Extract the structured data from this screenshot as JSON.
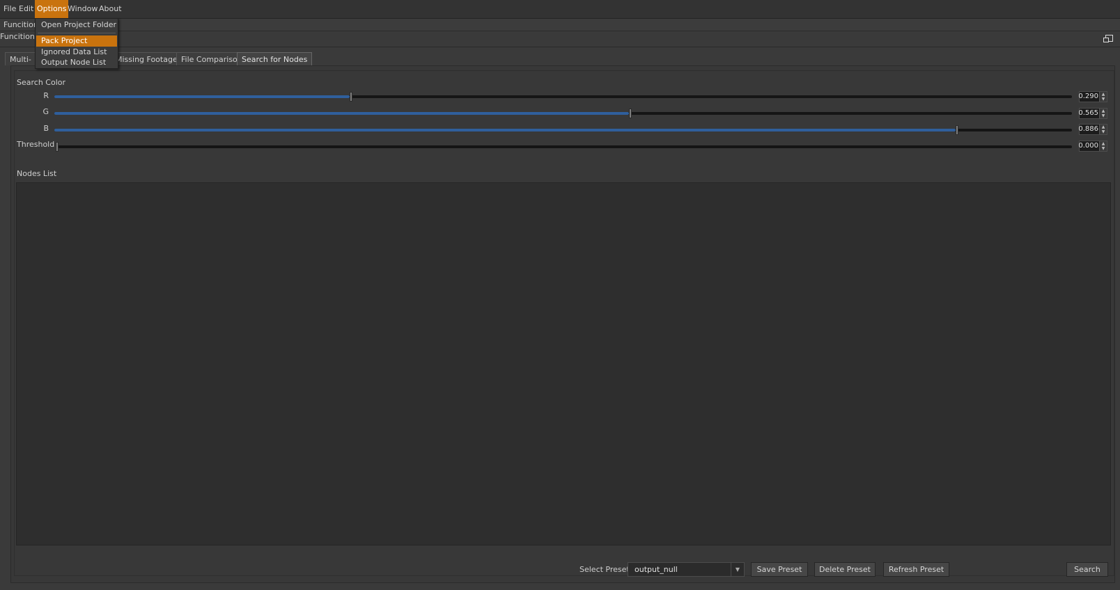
{
  "menubar": {
    "items": [
      {
        "label": "File"
      },
      {
        "label": "Edit"
      },
      {
        "label": "Options"
      },
      {
        "label": "Window"
      },
      {
        "label": "About"
      }
    ],
    "active": "Options"
  },
  "options_menu": {
    "items": [
      {
        "label": "Open Project Folder"
      },
      {
        "label": "Pack Project"
      },
      {
        "label": "Ignored Data List"
      },
      {
        "label": "Output Node List"
      }
    ],
    "highlighted": "Pack Project"
  },
  "function_bar": {
    "row1_label": "Funcition",
    "row2_label": "Funcitions"
  },
  "tabs": [
    {
      "label": "Multi-Pr"
    },
    {
      "label": "Missing Footages"
    },
    {
      "label": "File Comparison"
    },
    {
      "label": "Search for Nodes"
    }
  ],
  "selected_tab": "Search for Nodes",
  "search_color": {
    "title": "Search Color",
    "sliders": [
      {
        "label": "R",
        "value": "0.290",
        "fraction": 0.29
      },
      {
        "label": "G",
        "value": "0.565",
        "fraction": 0.565
      },
      {
        "label": "B",
        "value": "0.886",
        "fraction": 0.886
      },
      {
        "label": "Threshold",
        "value": "0.000",
        "fraction": 0.0
      }
    ]
  },
  "nodes_list": {
    "title": "Nodes List",
    "items": []
  },
  "bottom": {
    "preset_label": "Select Preset",
    "preset_value": "output_null",
    "save_preset": "Save Preset",
    "delete_preset": "Delete Preset",
    "refresh_preset": "Refresh Preset",
    "search": "Search"
  },
  "colors": {
    "accent": "#c9730e",
    "slider_fill": "#2f5f9c",
    "background": "#3a3a3a"
  }
}
